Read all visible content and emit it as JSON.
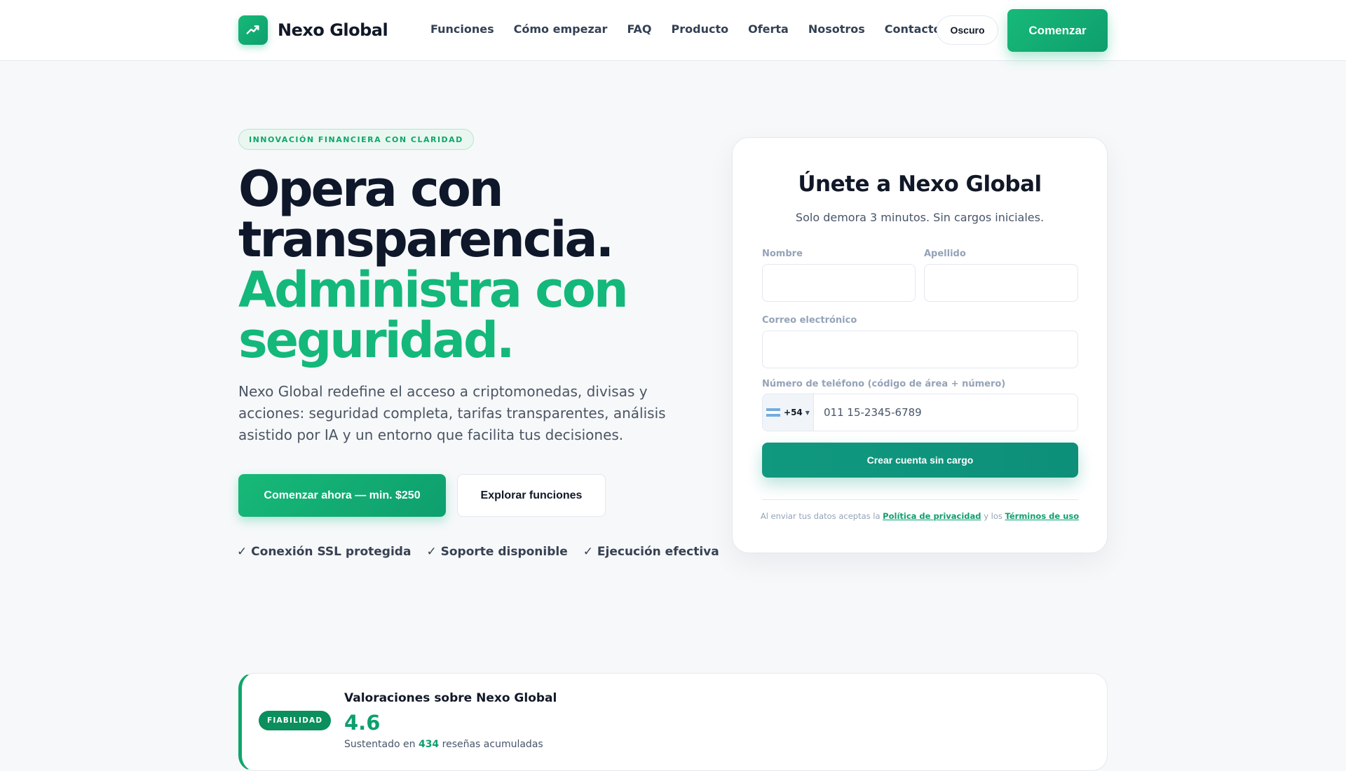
{
  "brand": {
    "name": "Nexo Global",
    "accent": "#14b87a"
  },
  "nav": {
    "items": [
      "Funciones",
      "Cómo empezar",
      "FAQ",
      "Producto",
      "Oferta",
      "Nosotros",
      "Contacto"
    ],
    "theme_toggle": "Oscuro",
    "cta": "Comenzar"
  },
  "hero": {
    "eyebrow": "INNOVACIÓN FINANCIERA CON CLARIDAD",
    "headline_line1": "Opera con",
    "headline_line2": "transparencia.",
    "headline_line3": "Administra con",
    "headline_line4": "seguridad.",
    "lead": "Nexo Global redefine el acceso a criptomonedas, divisas y acciones: seguridad completa, tarifas transparentes, análisis asistido por IA y un entorno que facilita tus decisiones.",
    "primary_button": "Comenzar ahora — min. $250",
    "secondary_button": "Explorar funciones",
    "trust": [
      "✓ Conexión SSL protegida",
      "✓ Soporte disponible",
      "✓ Ejecución efectiva"
    ]
  },
  "form": {
    "title": "Únete a Nexo Global",
    "subtitle": "Solo demora 3 minutos. Sin cargos iniciales.",
    "first_name_label": "Nombre",
    "last_name_label": "Apellido",
    "email_label": "Correo electrónico",
    "phone_label": "Número de teléfono (código de área + número)",
    "phone_code": "+54",
    "phone_placeholder": "011 15-2345-6789",
    "submit": "Crear cuenta sin cargo",
    "legal_prefix": "Al enviar tus datos aceptas la",
    "privacy_link": "Política de privacidad",
    "legal_mid": "y los",
    "terms_link": "Términos de uso"
  },
  "reviews": {
    "badge": "FIABILIDAD",
    "title": "Valoraciones sobre Nexo Global",
    "score": "4.6",
    "note_prefix": "Sustentado en",
    "count": "434",
    "note_suffix": "reseñas acumuladas"
  }
}
